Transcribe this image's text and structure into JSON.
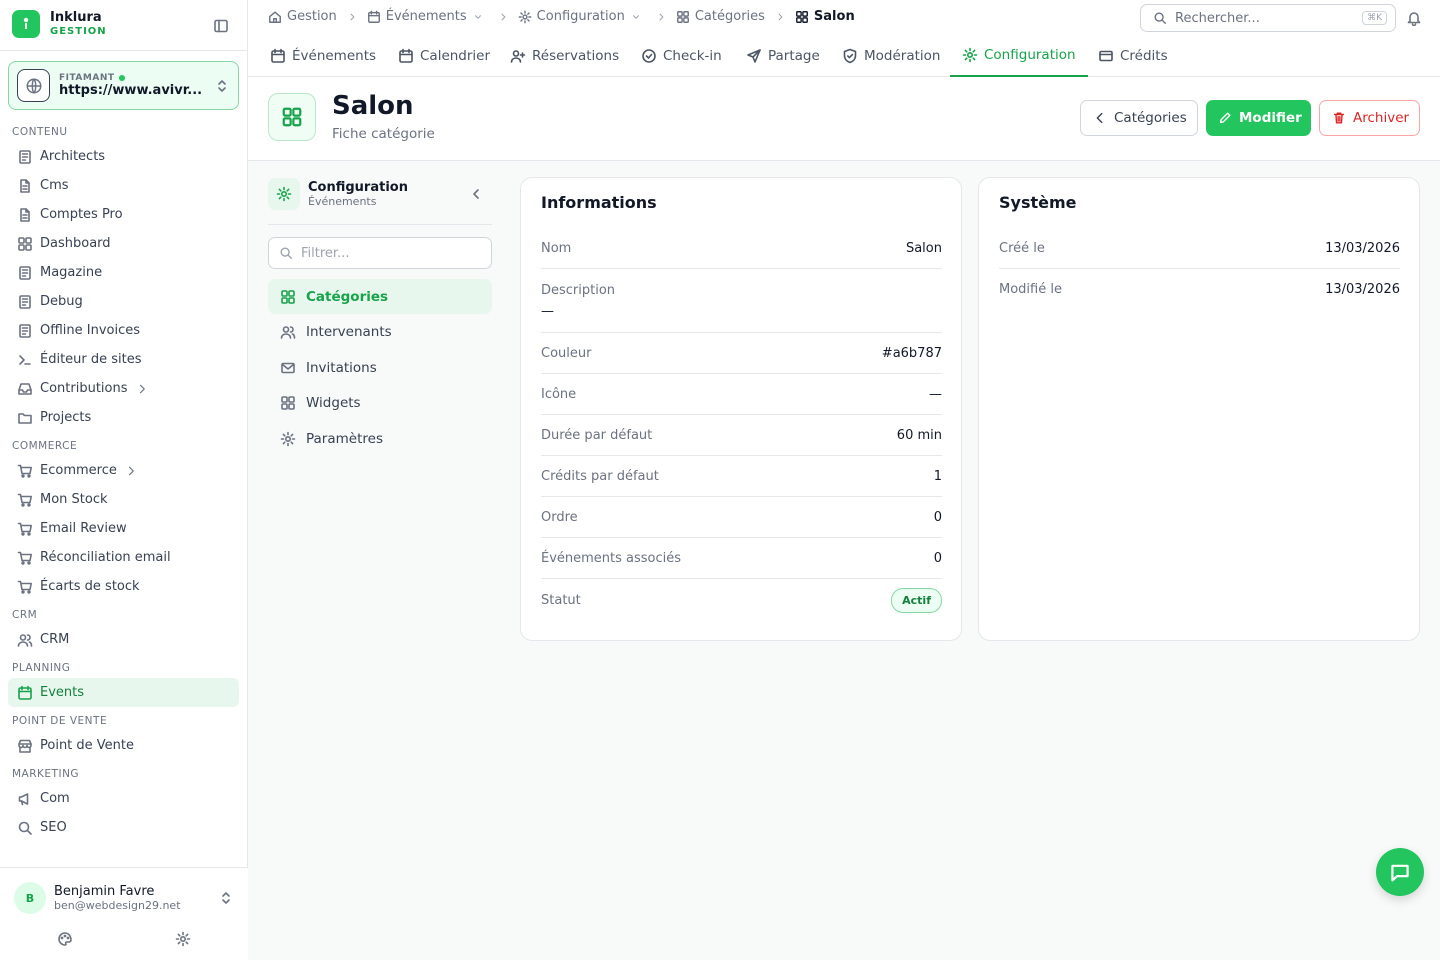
{
  "brand": {
    "name": "Inklura",
    "sub": "GESTION"
  },
  "workspace": {
    "label": "FITAMANT",
    "url": "https://www.avivr..."
  },
  "sidebar": {
    "sections": [
      {
        "title": "CONTENU",
        "items": [
          {
            "label": "Architects",
            "icon": "document-icon"
          },
          {
            "label": "Cms",
            "icon": "file-icon"
          },
          {
            "label": "Comptes Pro",
            "icon": "file-icon"
          },
          {
            "label": "Dashboard",
            "icon": "grid-icon"
          },
          {
            "label": "Magazine",
            "icon": "document-icon"
          },
          {
            "label": "Debug",
            "icon": "document-icon"
          },
          {
            "label": "Offline Invoices",
            "icon": "document-icon"
          },
          {
            "label": "Éditeur de sites",
            "icon": "terminal-icon"
          },
          {
            "label": "Contributions",
            "icon": "inbox-icon",
            "chevron": true
          },
          {
            "label": "Projects",
            "icon": "folder-icon"
          }
        ]
      },
      {
        "title": "COMMERCE",
        "items": [
          {
            "label": "Ecommerce",
            "icon": "cart-icon",
            "chevron": true
          },
          {
            "label": "Mon Stock",
            "icon": "cart-icon"
          },
          {
            "label": "Email Review",
            "icon": "cart-icon"
          },
          {
            "label": "Réconciliation email",
            "icon": "cart-icon"
          },
          {
            "label": "Écarts de stock",
            "icon": "cart-icon"
          }
        ]
      },
      {
        "title": "CRM",
        "items": [
          {
            "label": "CRM",
            "icon": "users-icon"
          }
        ]
      },
      {
        "title": "PLANNING",
        "items": [
          {
            "label": "Events",
            "icon": "calendar-icon",
            "active": true
          }
        ]
      },
      {
        "title": "POINT DE VENTE",
        "items": [
          {
            "label": "Point de Vente",
            "icon": "store-icon"
          }
        ]
      },
      {
        "title": "MARKETING",
        "items": [
          {
            "label": "Com",
            "icon": "megaphone-icon"
          },
          {
            "label": "SEO",
            "icon": "search-icon"
          }
        ]
      }
    ]
  },
  "user": {
    "initial": "B",
    "name": "Benjamin Favre",
    "email": "ben@webdesign29.net"
  },
  "breadcrumb": [
    {
      "label": "Gestion",
      "icon": "home-icon"
    },
    {
      "label": "Événements",
      "icon": "calendar-icon",
      "dropdown": true
    },
    {
      "label": "Configuration",
      "icon": "gear-icon",
      "dropdown": true
    },
    {
      "label": "Catégories",
      "icon": "grid-icon"
    },
    {
      "label": "Salon",
      "icon": "grid-icon",
      "current": true
    }
  ],
  "search": {
    "placeholder": "Rechercher...",
    "shortcut": "⌘K"
  },
  "tabs": [
    {
      "label": "Événements",
      "icon": "calendar-icon"
    },
    {
      "label": "Calendrier",
      "icon": "calendar-icon"
    },
    {
      "label": "Réservations",
      "icon": "user-plus-icon"
    },
    {
      "label": "Check-in",
      "icon": "check-circle-icon"
    },
    {
      "label": "Partage",
      "icon": "send-icon"
    },
    {
      "label": "Modération",
      "icon": "shield-icon"
    },
    {
      "label": "Configuration",
      "icon": "gear-icon",
      "active": true
    },
    {
      "label": "Crédits",
      "icon": "card-icon"
    }
  ],
  "page": {
    "title": "Salon",
    "subtitle": "Fiche catégorie",
    "back_label": "Catégories",
    "edit_label": "Modifier",
    "archive_label": "Archiver"
  },
  "config_panel": {
    "title": "Configuration",
    "subtitle": "Événements",
    "filter_placeholder": "Filtrer...",
    "items": [
      {
        "label": "Catégories",
        "icon": "grid-icon",
        "active": true
      },
      {
        "label": "Intervenants",
        "icon": "users-icon"
      },
      {
        "label": "Invitations",
        "icon": "mail-icon"
      },
      {
        "label": "Widgets",
        "icon": "grid-icon"
      },
      {
        "label": "Paramètres",
        "icon": "gear-icon"
      }
    ]
  },
  "info_card": {
    "title": "Informations",
    "rows": [
      {
        "label": "Nom",
        "value": "Salon"
      },
      {
        "label": "Description",
        "value": "—",
        "tall": true
      },
      {
        "label": "Couleur",
        "value": "#a6b787"
      },
      {
        "label": "Icône",
        "value": "—"
      },
      {
        "label": "Durée par défaut",
        "value": "60 min"
      },
      {
        "label": "Crédits par défaut",
        "value": "1"
      },
      {
        "label": "Ordre",
        "value": "0"
      },
      {
        "label": "Événements associés",
        "value": "0"
      },
      {
        "label": "Statut",
        "value": "Actif",
        "badge": true
      }
    ]
  },
  "system_card": {
    "title": "Système",
    "rows": [
      {
        "label": "Créé le",
        "value": "13/03/2026"
      },
      {
        "label": "Modifié le",
        "value": "13/03/2026"
      }
    ]
  },
  "colors": {
    "accent": "#22c55e",
    "accent_dark": "#16a34a",
    "danger": "#dc2626"
  }
}
